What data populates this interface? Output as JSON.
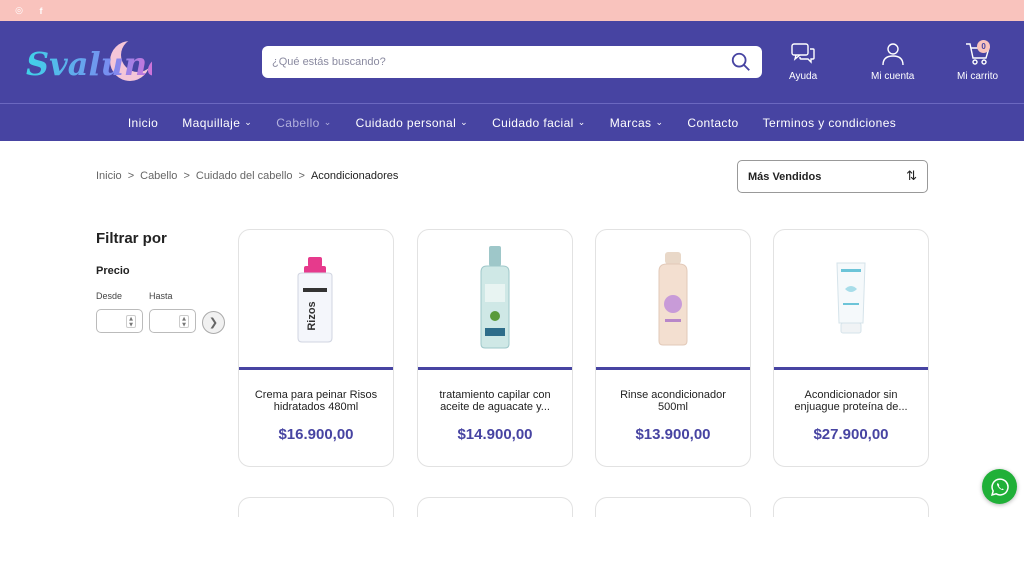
{
  "topbar": {
    "icons": [
      "instagram-icon",
      "facebook-icon"
    ]
  },
  "brand": {
    "logo_text": "Svaluna"
  },
  "search": {
    "placeholder": "¿Qué estás buscando?"
  },
  "header_actions": {
    "help_label": "Ayuda",
    "account_label": "Mi cuenta",
    "cart_label": "Mi carrito",
    "cart_count": "0"
  },
  "nav": {
    "items": [
      {
        "label": "Inicio"
      },
      {
        "label": "Maquillaje"
      },
      {
        "label": "Cabello"
      },
      {
        "label": "Cuidado personal"
      },
      {
        "label": "Cuidado facial"
      },
      {
        "label": "Marcas"
      },
      {
        "label": "Contacto"
      },
      {
        "label": "Terminos y condiciones"
      }
    ]
  },
  "breadcrumb": {
    "items": [
      "Inicio",
      "Cabello",
      "Cuidado del cabello"
    ],
    "separator": ">",
    "current": "Acondicionadores"
  },
  "sort": {
    "selected": "Más Vendidos"
  },
  "filters": {
    "title": "Filtrar por",
    "price_label": "Precio",
    "from_label": "Desde",
    "to_label": "Hasta"
  },
  "products": [
    {
      "name": "Crema para peinar Risos hidratados 480ml",
      "price": "$16.900,00",
      "bottle_label": "Rizos"
    },
    {
      "name": "tratamiento capilar con aceite de aguacate y...",
      "price": "$14.900,00"
    },
    {
      "name": "Rinse acondicionador 500ml",
      "price": "$13.900,00"
    },
    {
      "name": "Acondicionador sin enjuague proteína de...",
      "price": "$27.900,00"
    }
  ],
  "colors": {
    "brand_purple": "#4744a2",
    "topbar_pink": "#f9c3bd",
    "whatsapp_green": "#20b038"
  }
}
